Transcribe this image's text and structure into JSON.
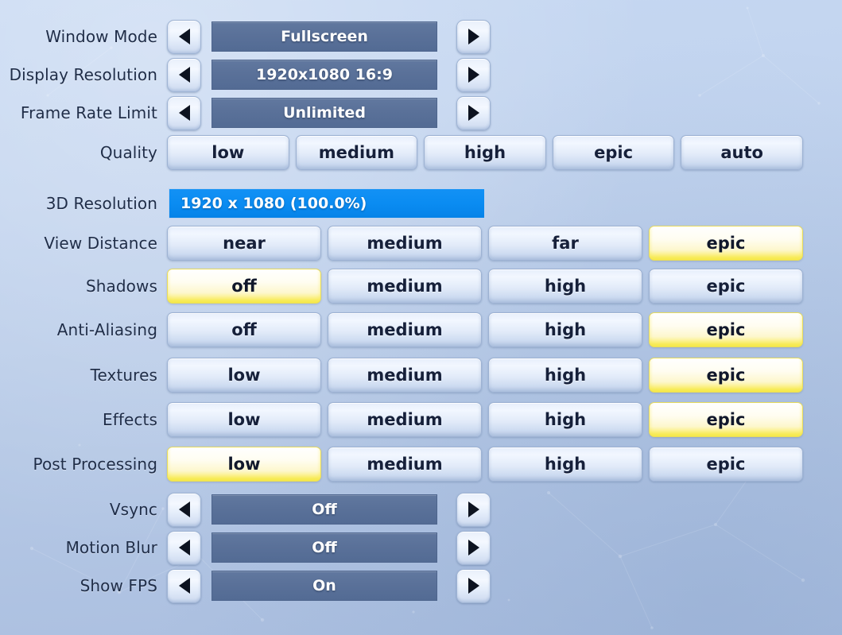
{
  "theme": {
    "background_top": "#c6d8f2",
    "background_bottom": "#aabedf",
    "label_color": "#1f2d48",
    "value_bar_color": "#5a7199",
    "slider_fill_color": "#0a8cf2",
    "selected_accent": "#f4e62a",
    "button_face": "#e2ebf9"
  },
  "settings_rows": [
    {
      "id": "window-mode",
      "label": "Window Mode",
      "type": "stepper",
      "value": "Fullscreen",
      "prev_icon": "left-arrow-icon",
      "next_icon": "right-arrow-icon"
    },
    {
      "id": "display-resolution",
      "label": "Display Resolution",
      "type": "stepper",
      "value": "1920x1080 16:9",
      "prev_icon": "left-arrow-icon",
      "next_icon": "right-arrow-icon"
    },
    {
      "id": "frame-rate-limit",
      "label": "Frame Rate Limit",
      "type": "stepper",
      "value": "Unlimited",
      "prev_icon": "left-arrow-icon",
      "next_icon": "right-arrow-icon"
    },
    {
      "id": "quality",
      "label": "Quality",
      "type": "options",
      "options": [
        "low",
        "medium",
        "high",
        "epic",
        "auto"
      ],
      "selected_index": -1
    },
    {
      "id": "3d-resolution",
      "label": "3D Resolution",
      "type": "slider",
      "value": "1920 x 1080 (100.0%)",
      "fill_percent": 100
    },
    {
      "id": "view-distance",
      "label": "View Distance",
      "type": "options",
      "options": [
        "near",
        "medium",
        "far",
        "epic"
      ],
      "selected_index": 3
    },
    {
      "id": "shadows",
      "label": "Shadows",
      "type": "options",
      "options": [
        "off",
        "medium",
        "high",
        "epic"
      ],
      "selected_index": 0
    },
    {
      "id": "anti-aliasing",
      "label": "Anti-Aliasing",
      "type": "options",
      "options": [
        "off",
        "medium",
        "high",
        "epic"
      ],
      "selected_index": 3
    },
    {
      "id": "textures",
      "label": "Textures",
      "type": "options",
      "options": [
        "low",
        "medium",
        "high",
        "epic"
      ],
      "selected_index": 3
    },
    {
      "id": "effects",
      "label": "Effects",
      "type": "options",
      "options": [
        "low",
        "medium",
        "high",
        "epic"
      ],
      "selected_index": 3
    },
    {
      "id": "post-processing",
      "label": "Post Processing",
      "type": "options",
      "options": [
        "low",
        "medium",
        "high",
        "epic"
      ],
      "selected_index": 0
    },
    {
      "id": "vsync",
      "label": "Vsync",
      "type": "stepper",
      "value": "Off",
      "prev_icon": "left-arrow-icon",
      "next_icon": "right-arrow-icon"
    },
    {
      "id": "motion-blur",
      "label": "Motion Blur",
      "type": "stepper",
      "value": "Off",
      "prev_icon": "left-arrow-icon",
      "next_icon": "right-arrow-icon"
    },
    {
      "id": "show-fps",
      "label": "Show FPS",
      "type": "stepper",
      "value": "On",
      "prev_icon": "left-arrow-icon",
      "next_icon": "right-arrow-icon"
    }
  ]
}
